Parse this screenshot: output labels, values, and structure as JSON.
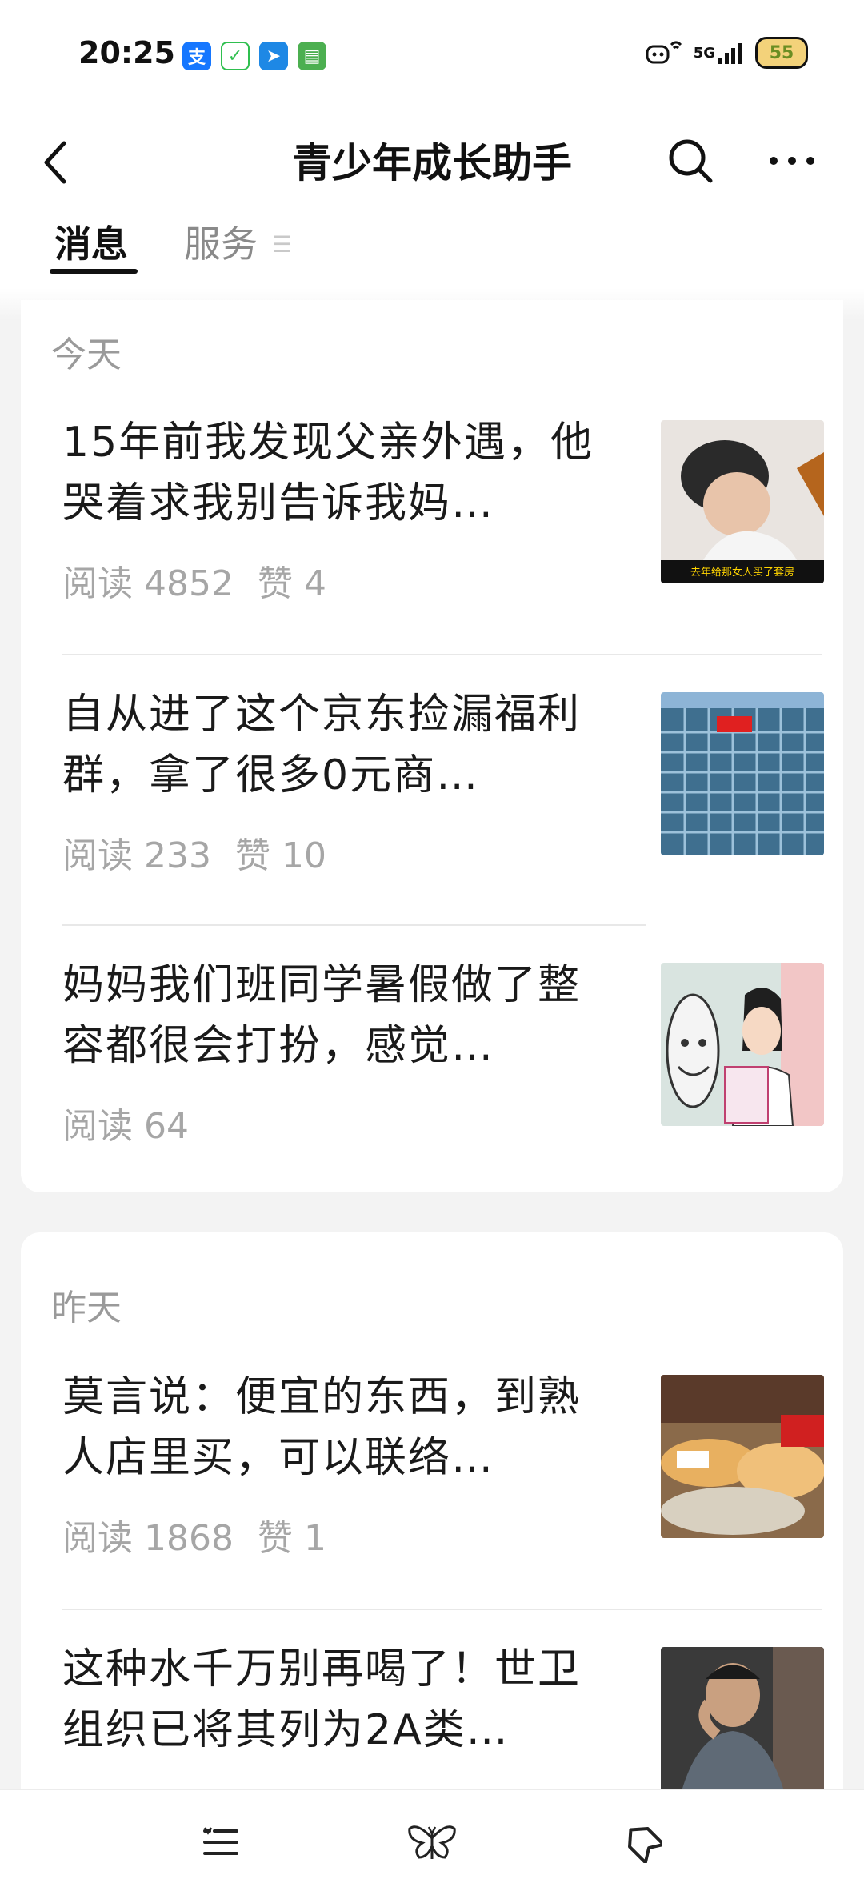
{
  "status_bar": {
    "time": "20:25",
    "app_icons": [
      {
        "name": "alipay-icon",
        "glyph": "支",
        "color": "#1677ff"
      },
      {
        "name": "shield-icon",
        "glyph": "✓",
        "color": "#2fbf4f"
      },
      {
        "name": "send-app-icon",
        "glyph": "➤",
        "color": "#1e88e5"
      },
      {
        "name": "message-app-icon",
        "glyph": "▤",
        "color": "#4caf50"
      }
    ],
    "network": "5G",
    "battery": "55"
  },
  "header": {
    "title": "青少年成长助手"
  },
  "tabs": [
    {
      "label": "消息",
      "active": true
    },
    {
      "label": "服务",
      "active": false
    }
  ],
  "sections": [
    {
      "label": "今天",
      "articles": [
        {
          "title": "15年前我发现父亲外遇，他哭着求我别告诉我妈…",
          "stats": [
            "阅读 4852",
            "赞 4"
          ],
          "thumb_caption": "去年给那女人买了套房"
        },
        {
          "title": "自从进了这个京东捡漏福利群，拿了很多0元商…",
          "stats": [
            "阅读 233",
            "赞 10"
          ],
          "thumb_caption": ""
        },
        {
          "title": "妈妈我们班同学暑假做了整容都很会打扮，感觉…",
          "stats": [
            "阅读 64"
          ],
          "thumb_caption": ""
        }
      ]
    },
    {
      "label": "昨天",
      "articles": [
        {
          "title": "莫言说：便宜的东西，到熟人店里买，可以联络…",
          "stats": [
            "阅读 1868",
            "赞 1"
          ],
          "thumb_caption": ""
        },
        {
          "title": "这种水千万别再喝了！世卫组织已将其列为2A类…",
          "stats": [],
          "thumb_caption": ""
        }
      ]
    }
  ],
  "bottom_nav": [
    {
      "name": "nav-list-icon",
      "glyph": "list"
    },
    {
      "name": "nav-butterfly-icon",
      "glyph": "butterfly"
    },
    {
      "name": "nav-tag-icon",
      "glyph": "tag"
    }
  ]
}
